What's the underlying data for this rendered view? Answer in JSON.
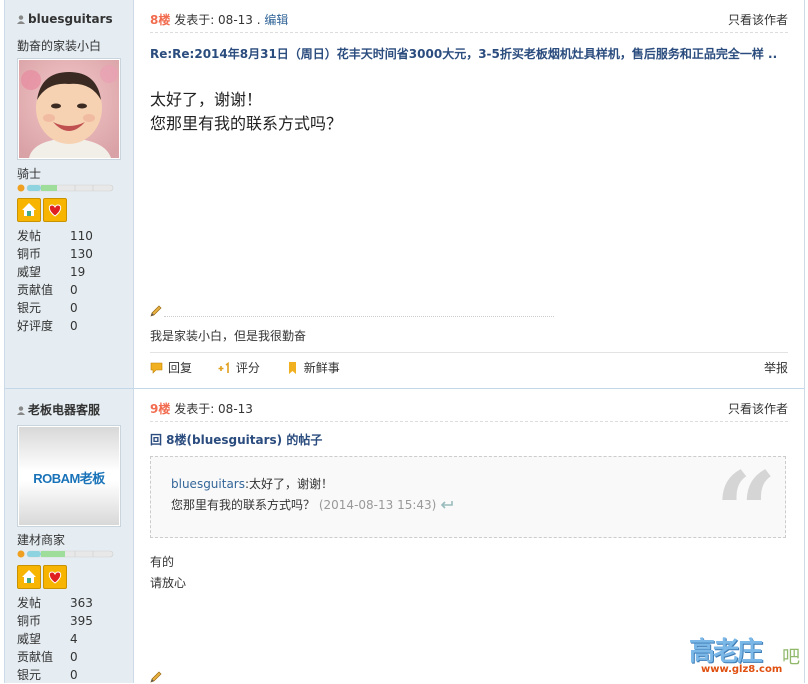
{
  "colors": {
    "floor": "#f26c4f",
    "title": "#2b4c7e",
    "link": "#336699",
    "sidebar": "#e5edf2"
  },
  "post1": {
    "username": "bluesguitars",
    "user_title": "勤奋的家装小白",
    "rank": "骑士",
    "stats": [
      {
        "label": "发帖",
        "value": "110"
      },
      {
        "label": "铜币",
        "value": "130"
      },
      {
        "label": "威望",
        "value": "19"
      },
      {
        "label": "贡献值",
        "value": "0"
      },
      {
        "label": "银元",
        "value": "0"
      },
      {
        "label": "好评度",
        "value": "0"
      }
    ],
    "floor": "8楼",
    "posted": "发表于: 08-13 .",
    "edit": "编辑",
    "author_only": "只看该作者",
    "title": "Re:Re:2014年8月31日（周日）花丰天时间省3000大元，3-5折买老板烟机灶具样机，售后服务和正品完全一样 ..",
    "body": [
      "太好了，谢谢！",
      "您那里有我的联系方式吗？"
    ],
    "signature": "我是家装小白，但是我很勤奋",
    "actions": {
      "reply": "回复",
      "rate": "评分",
      "fresh": "新鲜事",
      "report": "举报"
    }
  },
  "post2": {
    "username": "老板电器客服",
    "avatar_text": "ROBAM老板",
    "user_title": "建材商家",
    "stats": [
      {
        "label": "发帖",
        "value": "363"
      },
      {
        "label": "铜币",
        "value": "395"
      },
      {
        "label": "威望",
        "value": "4"
      },
      {
        "label": "贡献值",
        "value": "0"
      },
      {
        "label": "银元",
        "value": "0"
      }
    ],
    "floor": "9楼",
    "posted": "发表于: 08-13",
    "author_only": "只看该作者",
    "title": "回 8楼(bluesguitars) 的帖子",
    "quote": {
      "user": "bluesguitars",
      "line1": ":太好了，谢谢！",
      "line2": "您那里有我的联系方式吗？",
      "time": "(2014-08-13 15:43)"
    },
    "body": [
      "有的",
      "请放心"
    ]
  },
  "watermark": {
    "brand": "高老庄",
    "suffix": "吧",
    "url": "www.glz8.com"
  }
}
